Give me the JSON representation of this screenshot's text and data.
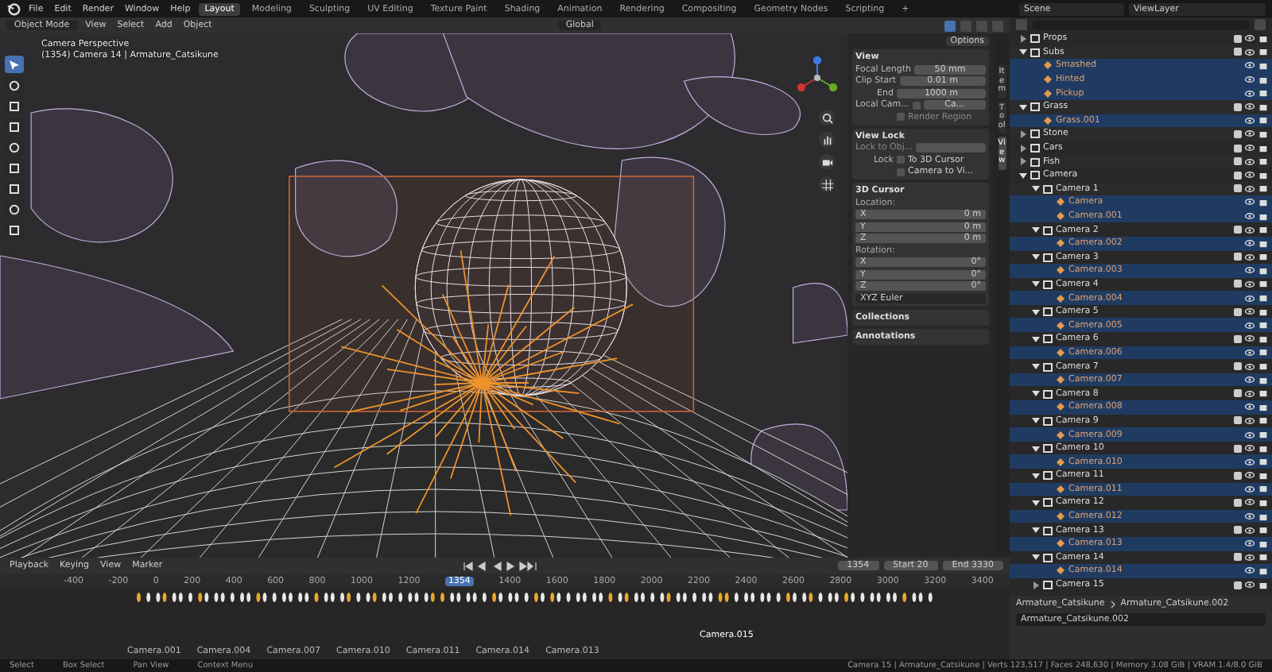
{
  "menu": [
    "File",
    "Edit",
    "Render",
    "Window",
    "Help"
  ],
  "workspaces": [
    {
      "label": "Layout",
      "selected": true
    },
    {
      "label": "Modeling",
      "selected": false
    },
    {
      "label": "Sculpting",
      "selected": false
    },
    {
      "label": "UV Editing",
      "selected": false
    },
    {
      "label": "Texture Paint",
      "selected": false
    },
    {
      "label": "Shading",
      "selected": false
    },
    {
      "label": "Animation",
      "selected": false
    },
    {
      "label": "Rendering",
      "selected": false
    },
    {
      "label": "Compositing",
      "selected": false
    },
    {
      "label": "Geometry Nodes",
      "selected": false
    },
    {
      "label": "Scripting",
      "selected": false
    },
    {
      "label": "+",
      "selected": false
    }
  ],
  "scene": "Scene",
  "view_layer": "ViewLayer",
  "viewport_header": {
    "mode": "Object Mode",
    "menus": [
      "View",
      "Select",
      "Add",
      "Object"
    ],
    "orientation": "Global",
    "options": "Options"
  },
  "tools": [
    {
      "selected": true
    },
    {
      "selected": false
    },
    {
      "selected": false
    },
    {
      "selected": false
    },
    {
      "selected": false
    },
    {
      "selected": false
    },
    {
      "selected": false
    },
    {
      "selected": false
    },
    {
      "selected": false
    }
  ],
  "viewport_info": [
    "Camera Perspective",
    "(1354) Camera 14 | Armature_Catsikune"
  ],
  "sidebar_tabs": [
    {
      "label": "Item",
      "selected": false
    },
    {
      "label": "Tool",
      "selected": false
    },
    {
      "label": "View",
      "selected": true
    }
  ],
  "sidebar": {
    "view_title": "View",
    "view_fields": [
      {
        "label": "Focal Length",
        "value": "50 mm"
      },
      {
        "label": "Clip Start",
        "value": "0.01 m"
      },
      {
        "label": "End",
        "value": "1000 m"
      }
    ],
    "local_camera": {
      "label": "Local Cam...",
      "checked": false,
      "value": "Ca..."
    },
    "render_region": {
      "label": "Render Region",
      "checked": false
    },
    "view_lock_title": "View Lock",
    "lock_object_label": "Lock to Obj...",
    "lock_label": "Lock",
    "lock_options": [
      {
        "label": "To 3D Cursor",
        "checked": false
      },
      {
        "label": "Camera to Vi...",
        "checked": false
      }
    ],
    "cursor_title": "3D Cursor",
    "location_label": "Location:",
    "location": [
      {
        "axis": "X",
        "value": "0 m"
      },
      {
        "axis": "Y",
        "value": "0 m"
      },
      {
        "axis": "Z",
        "value": "0 m"
      }
    ],
    "rotation_label": "Rotation:",
    "rotation": [
      {
        "axis": "X",
        "value": "0°"
      },
      {
        "axis": "Y",
        "value": "0°"
      },
      {
        "axis": "Z",
        "value": "0°"
      }
    ],
    "rotation_mode": "XYZ Euler",
    "collapsed_panels": [
      "Collections",
      "Annotations"
    ]
  },
  "outliner": {
    "items": [
      {
        "name": "Props",
        "kind": "collection",
        "selected": false,
        "expanded": false
      },
      {
        "name": "Subs",
        "kind": "collection",
        "selected": false,
        "expanded": true,
        "children": [
          {
            "name": "Smashed",
            "kind": "object",
            "selected": true
          },
          {
            "name": "Hinted",
            "kind": "object",
            "selected": true
          },
          {
            "name": "Pickup",
            "kind": "object",
            "selected": true
          }
        ]
      },
      {
        "name": "Grass",
        "kind": "collection",
        "selected": false,
        "expanded": true,
        "children": [
          {
            "name": "Grass.001",
            "kind": "object",
            "selected": true
          }
        ]
      },
      {
        "name": "Stone",
        "kind": "collection",
        "selected": false,
        "expanded": false
      },
      {
        "name": "Cars",
        "kind": "collection",
        "selected": false,
        "expanded": false
      },
      {
        "name": "Fish",
        "kind": "collection",
        "selected": false,
        "expanded": false
      },
      {
        "name": "Camera",
        "kind": "collection",
        "selected": false,
        "expanded": true,
        "children": [
          {
            "name": "Camera 1",
            "kind": "collection",
            "selected": false,
            "expanded": true,
            "children": [
              {
                "name": "Camera",
                "kind": "object",
                "selected": true
              },
              {
                "name": "Camera.001",
                "kind": "object",
                "selected": true
              }
            ]
          },
          {
            "name": "Camera 2",
            "kind": "collection",
            "selected": false,
            "expanded": true,
            "children": [
              {
                "name": "Camera.002",
                "kind": "object",
                "selected": true
              }
            ]
          },
          {
            "name": "Camera 3",
            "kind": "collection",
            "selected": false,
            "expanded": true,
            "children": [
              {
                "name": "Camera.003",
                "kind": "object",
                "selected": true
              }
            ]
          },
          {
            "name": "Camera 4",
            "kind": "collection",
            "selected": false,
            "expanded": true,
            "children": [
              {
                "name": "Camera.004",
                "kind": "object",
                "selected": true
              }
            ]
          },
          {
            "name": "Camera 5",
            "kind": "collection",
            "selected": false,
            "expanded": true,
            "children": [
              {
                "name": "Camera.005",
                "kind": "object",
                "selected": true
              }
            ]
          },
          {
            "name": "Camera 6",
            "kind": "collection",
            "selected": false,
            "expanded": true,
            "children": [
              {
                "name": "Camera.006",
                "kind": "object",
                "selected": true
              }
            ]
          },
          {
            "name": "Camera 7",
            "kind": "collection",
            "selected": false,
            "expanded": true,
            "children": [
              {
                "name": "Camera.007",
                "kind": "object",
                "selected": true
              }
            ]
          },
          {
            "name": "Camera 8",
            "kind": "collection",
            "selected": false,
            "expanded": true,
            "children": [
              {
                "name": "Camera.008",
                "kind": "object",
                "selected": true
              }
            ]
          },
          {
            "name": "Camera 9",
            "kind": "collection",
            "selected": false,
            "expanded": true,
            "children": [
              {
                "name": "Camera.009",
                "kind": "object",
                "selected": true
              }
            ]
          },
          {
            "name": "Camera 10",
            "kind": "collection",
            "selected": false,
            "expanded": true,
            "children": [
              {
                "name": "Camera.010",
                "kind": "object",
                "selected": true
              }
            ]
          },
          {
            "name": "Camera 11",
            "kind": "collection",
            "selected": false,
            "expanded": true,
            "children": [
              {
                "name": "Camera.011",
                "kind": "object",
                "selected": true
              }
            ]
          },
          {
            "name": "Camera 12",
            "kind": "collection",
            "selected": false,
            "expanded": true,
            "children": [
              {
                "name": "Camera.012",
                "kind": "object",
                "selected": true
              }
            ]
          },
          {
            "name": "Camera 13",
            "kind": "collection",
            "selected": false,
            "expanded": true,
            "children": [
              {
                "name": "Camera.013",
                "kind": "object",
                "selected": true
              }
            ]
          },
          {
            "name": "Camera 14",
            "kind": "collection",
            "selected": false,
            "expanded": true,
            "children": [
              {
                "name": "Camera.014",
                "kind": "object",
                "selected": true
              }
            ]
          },
          {
            "name": "Camera 15",
            "kind": "collection",
            "selected": false,
            "expanded": false
          }
        ]
      }
    ]
  },
  "properties": {
    "breadcrumb": [
      "Armature_Catsikune",
      "Armature_Catsikune.002"
    ],
    "name_field": "Armature_Catsikune.002"
  },
  "timeline": {
    "menus": [
      "Playback",
      "Keying",
      "View",
      "Marker"
    ],
    "current_frame": "1354",
    "start_label": "Start",
    "start": "20",
    "end_label": "End",
    "end": "3330",
    "ticks": [
      "-400",
      "-200",
      "0",
      "200",
      "400",
      "600",
      "800",
      "1000",
      "1200",
      "1400",
      "1600",
      "1800",
      "2000",
      "2200",
      "2400",
      "2600",
      "2800",
      "3000",
      "3200",
      "3400"
    ],
    "current_frame_indicator": "1354",
    "markers": [
      "Camera.001",
      "Camera.004",
      "Camera.007",
      "Camera.010",
      "Camera.011",
      "Camera.014",
      "Camera.013"
    ],
    "active_marker": "Camera.015"
  },
  "status_bar": {
    "hints": [
      "Select",
      "Box Select",
      "Pan View",
      "Context Menu"
    ],
    "stats": "Camera 15 | Armature_Catsikune | Verts 123,517 | Faces 248,630 | Memory 3.08 GiB | VRAM 1.4/8.0 GiB"
  }
}
